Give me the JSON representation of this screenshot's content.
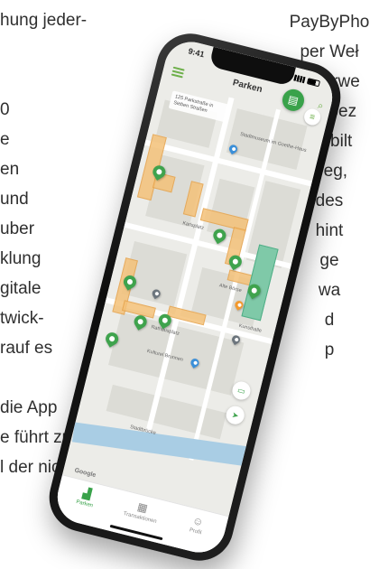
{
  "background_text": {
    "left": [
      "hung jeder-",
      "",
      "",
      "0",
      "e",
      "en",
      "und",
      "uber",
      "klung",
      "gitale",
      "twick-",
      "rauf es",
      "",
      "die App",
      "e führt zu",
      "l der nicht"
    ],
    "right": [
      "PayByPho",
      "per Weł",
      "unterwe",
      "ist, bez",
      "Mobilt",
      "weg,",
      "des",
      "hint",
      "ge",
      "wa",
      "d",
      "p"
    ]
  },
  "status_bar": {
    "time": "9:41"
  },
  "app": {
    "title": "Parken",
    "address": "125 Parkstraße in Sieben Straßen",
    "map_labels": {
      "poi_1": "Stadtmuseum im Goethe-Haus",
      "street_1": "Karlsplatz",
      "poi_2": "Alte Börse",
      "poi_3": "Rathausplatz",
      "poi_4": "Kunsthalle",
      "poi_5": "Kulturel Brunnen",
      "poi_6": "Stadtbrücke",
      "poi_7": "Marktplatz"
    },
    "brand": "Google"
  },
  "tabbar": {
    "tabs": [
      {
        "label": "Parken",
        "icon": "car-icon",
        "active": true
      },
      {
        "label": "Transaktionen",
        "icon": "receipt-icon",
        "active": false
      },
      {
        "label": "Profil",
        "icon": "user-icon",
        "active": false
      }
    ]
  },
  "colors": {
    "accent": "#39a24a",
    "zone_orange": "#f4c178",
    "zone_green": "#7fc9a8",
    "water": "#a9cde4"
  }
}
